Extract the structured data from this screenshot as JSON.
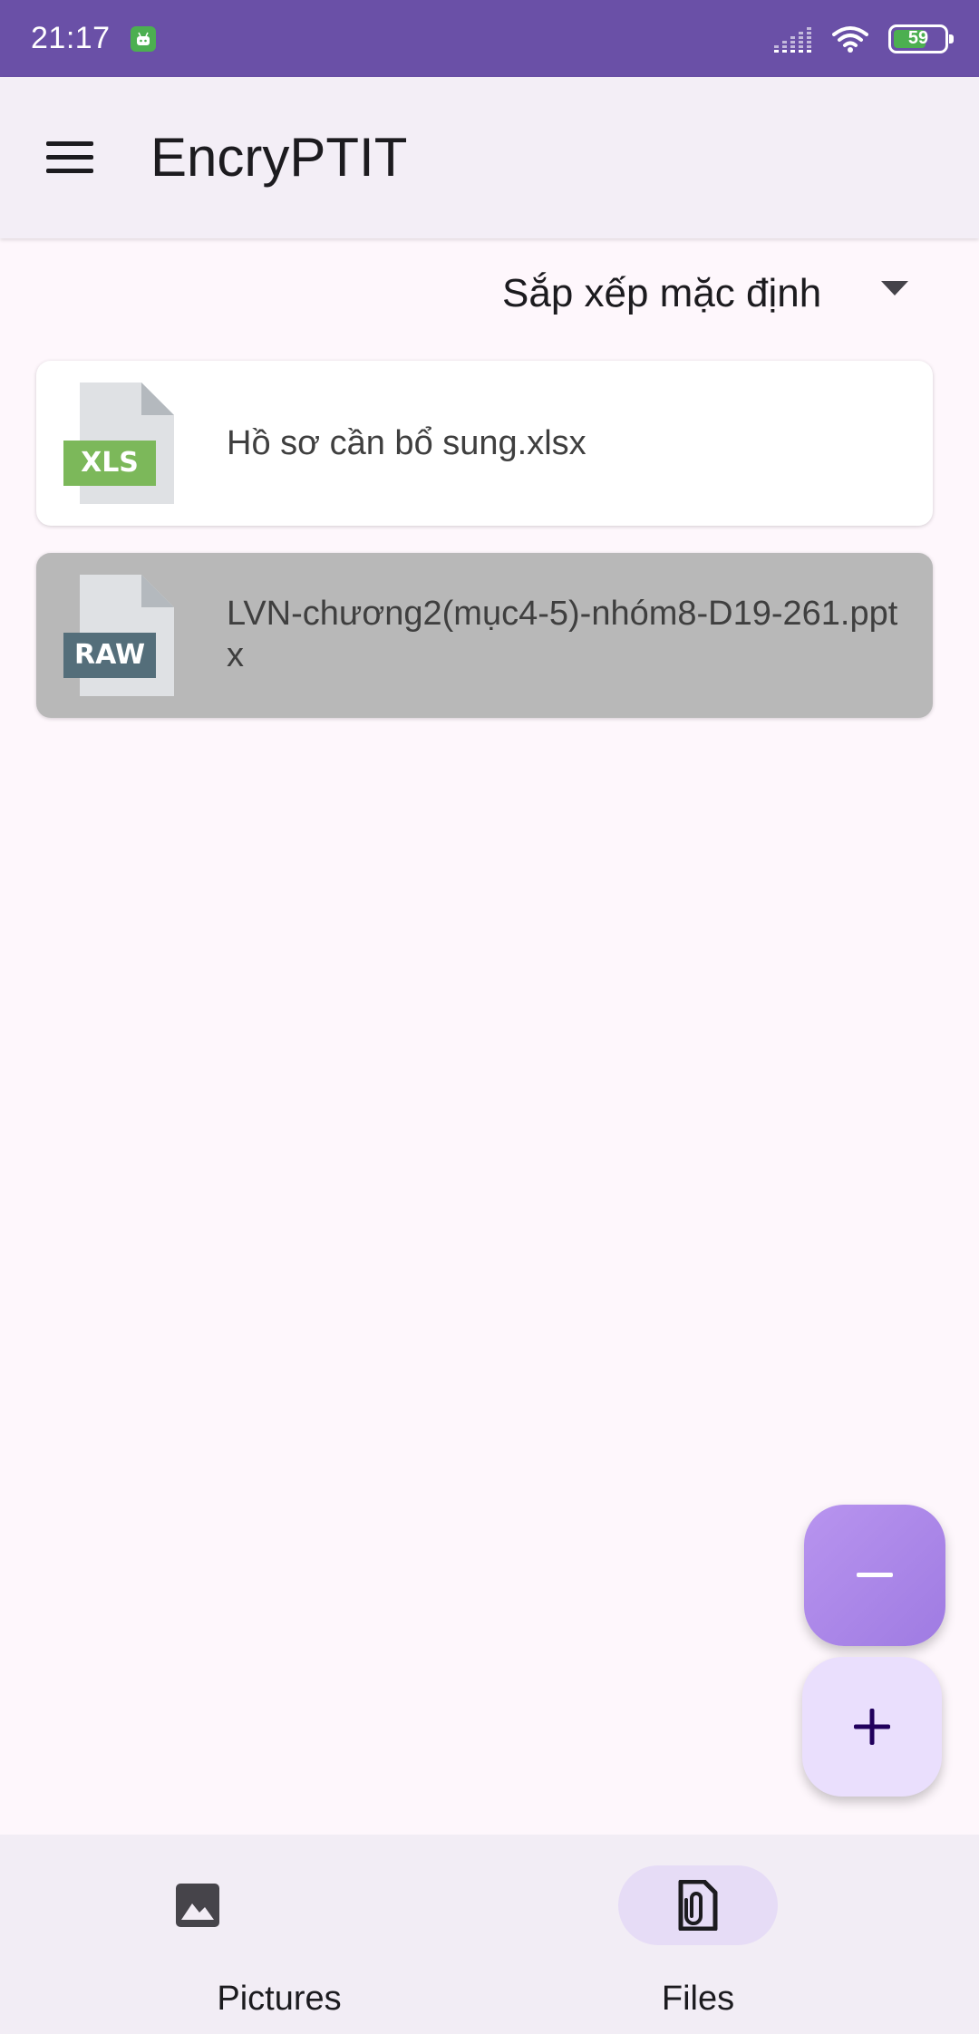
{
  "status_bar": {
    "time": "21:17",
    "battery_level": "59",
    "notification_icon": "android-robot-icon",
    "signal_icon": "signal-bars-icon",
    "wifi_icon": "wifi-icon",
    "battery_icon": "battery-icon"
  },
  "app_bar": {
    "title": "EncryPTIT",
    "menu_icon": "hamburger-menu-icon"
  },
  "sort": {
    "label": "Sắp xếp mặc định",
    "icon": "dropdown-arrow-icon"
  },
  "files": [
    {
      "name": "Hồ sơ cần bổ sung.xlsx",
      "type_badge": "XLS",
      "badge_color": "#7cb85a",
      "selected": false
    },
    {
      "name": "LVN-chương2(mục4-5)-nhóm8-D19-261.pptx",
      "type_badge": "RAW",
      "badge_color": "#546e7a",
      "selected": true
    }
  ],
  "fabs": {
    "remove_icon": "minus-icon",
    "add_icon": "plus-icon"
  },
  "bottom_nav": {
    "items": [
      {
        "label": "Pictures",
        "icon": "image-icon",
        "active": false
      },
      {
        "label": "Files",
        "icon": "file-attachment-icon",
        "active": true
      }
    ]
  },
  "colors": {
    "status_bar": "#6a50a7",
    "app_bar": "#f3eef6",
    "background": "#fef7fc",
    "selected_card": "#b8b8b8",
    "fab_remove": "#a985e8",
    "fab_add": "#eadffd",
    "nav_active_pill": "#e6dcf6"
  }
}
